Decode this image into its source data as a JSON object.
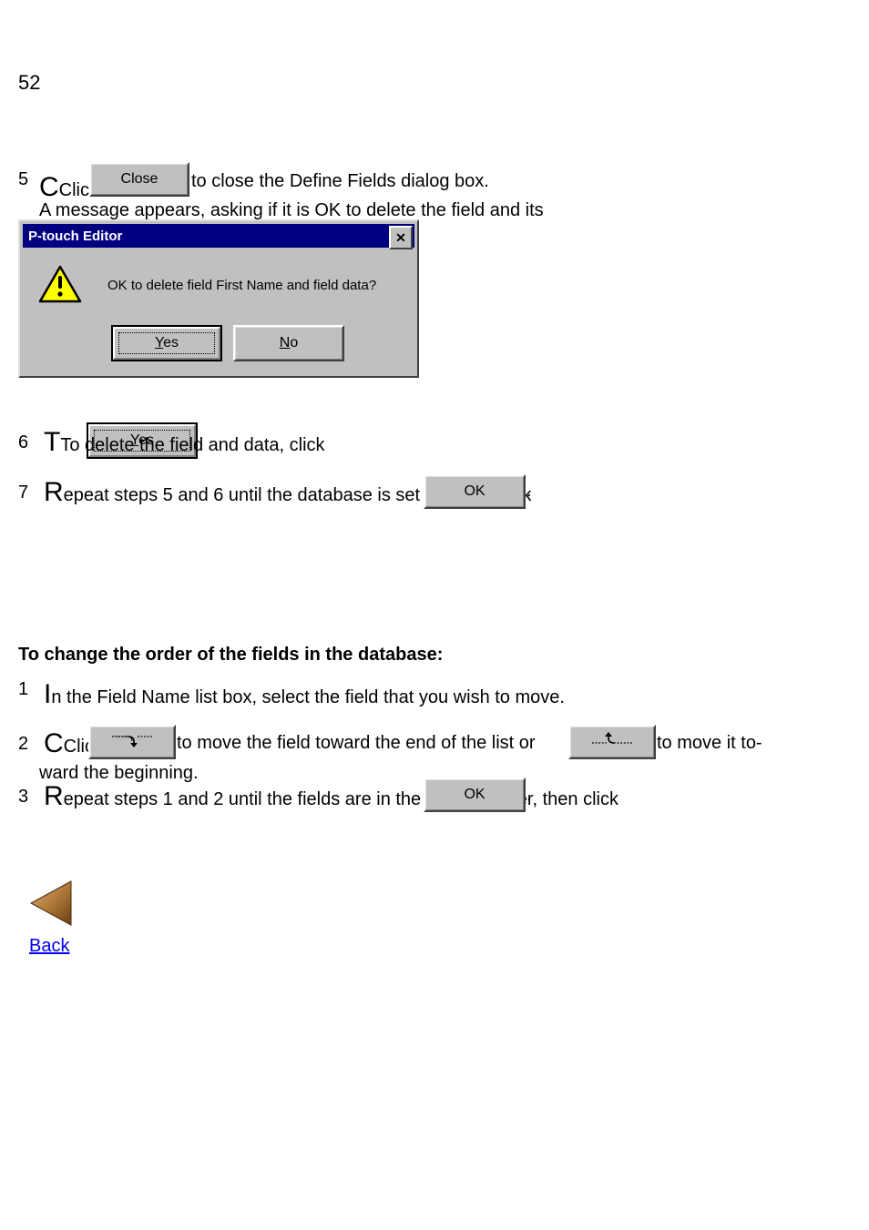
{
  "page_number": "52",
  "step5": {
    "num": "5",
    "text_a": "Click ",
    "text_b": " to close the Define Fields dialog box."
  },
  "step6": {
    "text": "A message appears, asking if it is OK to delete the field and its data."
  },
  "buttons": {
    "close": "Close",
    "yes": "Yes",
    "no": "No",
    "ok": "OK",
    "yes_mnemonic": "Y",
    "yes_rest": "es",
    "no_mnemonic": "N",
    "no_rest": "o"
  },
  "dialog": {
    "title": "P-touch Editor",
    "message": "OK to delete field First Name and field data?",
    "close_glyph": "✕"
  },
  "step7": {
    "num": "6",
    "text_a": "To delete the field and data, click ",
    "text_b": "."
  },
  "step8": {
    "num": "7",
    "text_a": "Repeat steps ",
    "text_b": " and ",
    "text_c": " until the database is set up, then click ",
    "text_d": ".",
    "ref1": "5",
    "ref2": "6"
  },
  "section_heading": "To change the order of the fields in the database:",
  "orderA": {
    "num": "1",
    "text": "In the Field Name list box, select the field that you wish to move."
  },
  "orderB": {
    "num": "2",
    "text_a": "Click ",
    "text_b": " to move the field toward the end of the list or ",
    "text_c": " to move it to-",
    "text_d": "ward the beginning."
  },
  "orderC": {
    "num": "3",
    "text_a": "Repeat steps ",
    "text_b": " and ",
    "text_c": " until the fields are in the desired order, then click ",
    "text_d": ".",
    "ref1": "1",
    "ref2": "2"
  },
  "nav": {
    "back": "Back"
  }
}
